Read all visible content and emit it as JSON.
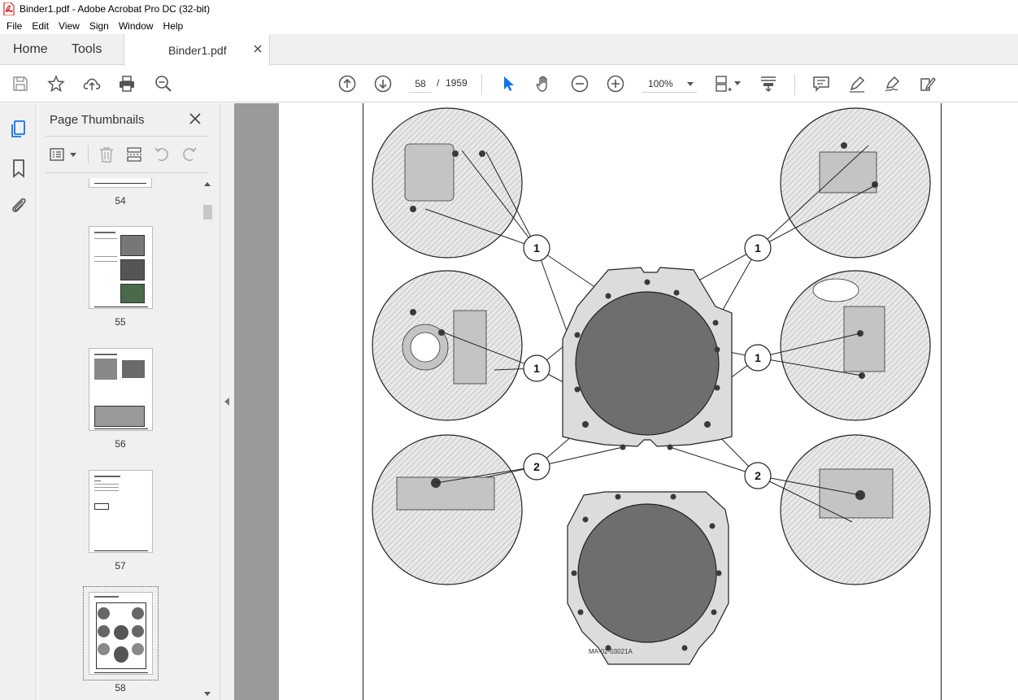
{
  "window": {
    "title": "Binder1.pdf - Adobe Acrobat Pro DC (32-bit)"
  },
  "menu": [
    "File",
    "Edit",
    "View",
    "Sign",
    "Window",
    "Help"
  ],
  "tabs": {
    "home": "Home",
    "tools": "Tools",
    "document": "Binder1.pdf"
  },
  "toolbar": {
    "current_page": "58",
    "page_separator": "/",
    "total_pages": "1959",
    "zoom": "100%"
  },
  "panel": {
    "title": "Page Thumbnails",
    "thumbnails": [
      {
        "label": "54"
      },
      {
        "label": "55"
      },
      {
        "label": "56"
      },
      {
        "label": "57"
      },
      {
        "label": "58"
      }
    ]
  },
  "figure": {
    "callouts": [
      "1",
      "1",
      "1",
      "1",
      "2",
      "2"
    ],
    "code": "MA-02-03021A"
  },
  "colors": {
    "accent": "#1473e6",
    "chrome_bg": "#f0f0f0",
    "viewer_gray": "#9a9a9a",
    "part_fill": "#d8d8d8",
    "disc_fill": "#6e6e6e"
  }
}
